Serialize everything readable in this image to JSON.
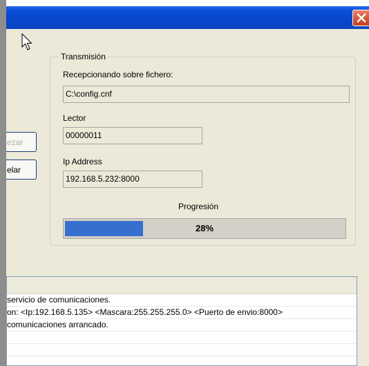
{
  "dialog": {
    "left_buttons": {
      "start_label": "ezar",
      "cancel_label": "elar"
    },
    "group": {
      "legend": "Transmisión",
      "file_label": "Recepcionando sobre fichero:",
      "file_value": "C:\\config.cnf",
      "reader_label": "Lector",
      "reader_value": "00000011",
      "ip_label": "Ip Address",
      "ip_value": "192.168.5.232:8000",
      "progress_label": "Progresión",
      "progress_text": "28%",
      "progress_fraction": 0.28
    }
  },
  "log": {
    "rows": [
      " servicio de comunicaciones.",
      "on:  <Ip:192.168.5.135> <Mascara:255.255.255.0> <Puerto de envio:8000>",
      " comunicaciones arrancado.",
      "",
      "",
      ""
    ]
  },
  "colors": {
    "titlebar": "#0a4fd8",
    "dialog_bg": "#ece9d8",
    "progress_fill": "#3670cf",
    "close_button": "#d3522f"
  },
  "icons": [
    "close-icon",
    "mouse-cursor-icon"
  ]
}
